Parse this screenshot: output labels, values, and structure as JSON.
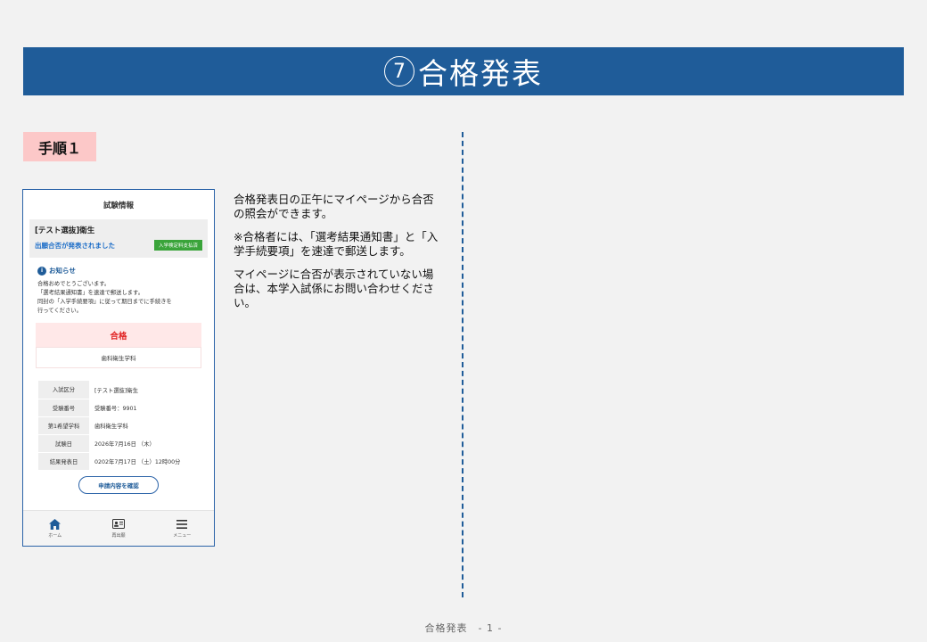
{
  "header": {
    "number": "7",
    "title": "合格発表"
  },
  "step_label": "手順１",
  "phone": {
    "header_title": "試験情報",
    "exam": {
      "name": "[テスト選抜]衛生",
      "status": "出願合否が発表されました",
      "fee_tag": "入学検定料支払済"
    },
    "notice": {
      "title": "お知らせ",
      "lines": [
        "合格おめでとうございます。",
        "「選考結果通知書」を速達で郵送します。",
        "同封の「入学手続要項」に従って期日までに手続きを",
        "行ってください。"
      ]
    },
    "result": "合格",
    "department": "歯科衛生学科",
    "table": [
      {
        "label": "入試区分",
        "value": "[テスト選抜]衛生"
      },
      {
        "label": "受験番号",
        "value": "受験番号：9901"
      },
      {
        "label": "第1希望学科",
        "value": "歯科衛生学科"
      },
      {
        "label": "試験日",
        "value": "2026年7月16日 （木）"
      },
      {
        "label": "結果発表日",
        "value": "0202年7月17日 （土）12時00分"
      }
    ],
    "confirm_button": "申請内容を確認",
    "nav": [
      {
        "label": "ホーム",
        "icon": "home-icon"
      },
      {
        "label": "再出願",
        "icon": "id-card-icon"
      },
      {
        "label": "メニュー",
        "icon": "menu-icon"
      }
    ]
  },
  "description": [
    "合格発表日の正午にマイページから合否の照会ができます。",
    "※合格者には、「選考結果通知書」と「入学手続要項」を速達で郵送します。",
    "マイページに合否が表示されていない場合は、本学入試係にお問い合わせください。"
  ],
  "footer": "合格発表　- 1 -",
  "colors": {
    "primary": "#1f5c99",
    "badge": "#fcc8c8",
    "pass": "#e02020",
    "fee_tag": "#3aa43a"
  }
}
